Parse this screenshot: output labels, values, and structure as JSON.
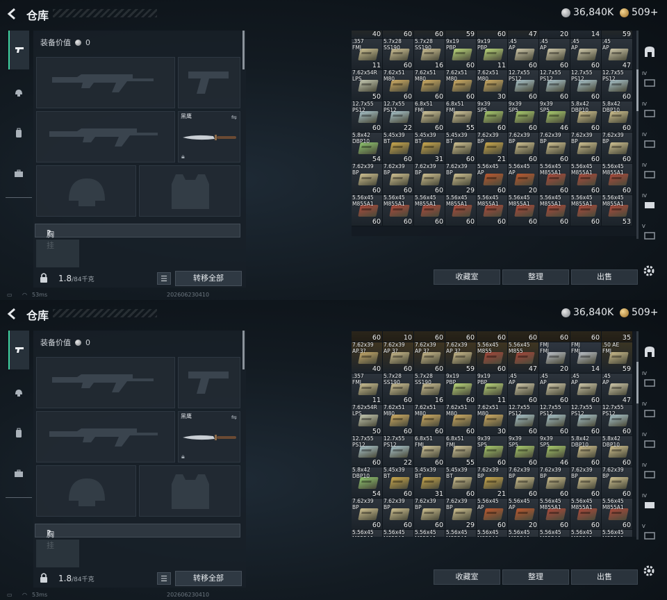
{
  "header": {
    "title": "仓库",
    "silver": "36,840K",
    "gold": "509+"
  },
  "gear": {
    "equip_value_label": "装备价值",
    "equip_value": "0",
    "knife_name": "黑鹰",
    "chest_rig_label": "胸挂",
    "chest_rig_help": "?",
    "weight": "1.8",
    "weight_max": "/84千克",
    "transfer_all": "转移全部"
  },
  "status": {
    "ping": "53ms",
    "build": "202606230410"
  },
  "actions": {
    "collection": "收藏室",
    "sort": "整理",
    "sell": "出售"
  },
  "tabs": {
    "left": [
      "weapon-tab",
      "armor-tab",
      "bag-tab",
      "case-tab"
    ]
  },
  "colors": {
    "accent": "#3fd4a2",
    "panel": "#182028"
  },
  "stash_rows": [
    [
      {
        "label": "7.62x39\nAP.3?",
        "count": "40",
        "color": "#c3a86a",
        "bg": "#3f3521"
      },
      {
        "label": "7.62x39\nAP 3?",
        "count": "60",
        "color": "#c9b98b",
        "bg": "#3f3521"
      },
      {
        "label": "7.62x39\nAP 3?",
        "count": "60",
        "color": "#c9b98b",
        "bg": "#3f3521"
      },
      {
        "label": "7.62x39\nAP 3?",
        "count": "59",
        "color": "#c9b98b",
        "bg": "#3f3521"
      },
      {
        "label": "5.56x45\nM855",
        "count": "60",
        "color": "#a5473a",
        "bg": "#3f3521"
      },
      {
        "label": "5.56x45\nM855",
        "count": "47",
        "color": "#a5473a",
        "bg": "#3f3521"
      },
      {
        "label": "FMJ\nFMJ",
        "count": "20",
        "color": "#b9bec6",
        "bg": "#2f3640"
      },
      {
        "label": "FMJ\nFMJ",
        "count": "14",
        "color": "#b9bec6",
        "bg": "#2f3640"
      },
      {
        "label": ".50 AE\nFMJ",
        "count": "59",
        "color": "#c8b98a",
        "bg": "#3a3524"
      }
    ],
    [
      {
        "label": ".357\nFMJ",
        "count": "11",
        "color": "#cbbf92",
        "bg": "#2d343c"
      },
      {
        "label": "5.7x28\nSS190",
        "count": "60",
        "color": "#cfc296",
        "bg": "#2d343c"
      },
      {
        "label": "5.7x28\nSS190",
        "count": "16",
        "color": "#cfc296",
        "bg": "#2d343c"
      },
      {
        "label": "9x19\nPBP",
        "count": "60",
        "color": "#b8d47a",
        "bg": "#2d343c"
      },
      {
        "label": "9x19\nPBP",
        "count": "11",
        "color": "#b8d47a",
        "bg": "#2d343c"
      },
      {
        "label": ".45\nAP",
        "count": "60",
        "color": "#cdc6a8",
        "bg": "#2d343c"
      },
      {
        "label": ".45\nAP",
        "count": "60",
        "color": "#cdc6a8",
        "bg": "#2d343c"
      },
      {
        "label": ".45\nAP",
        "count": "60",
        "color": "#cdc6a8",
        "bg": "#2d343c"
      },
      {
        "label": ".45\nAP",
        "count": "47",
        "color": "#cdc6a8",
        "bg": "#2d343c"
      }
    ],
    [
      {
        "label": "7.62x54R\nLPS",
        "count": "50",
        "color": "#c3c7b0",
        "bg": "#2d343c"
      },
      {
        "label": "7.62x51\nM80",
        "count": "60",
        "color": "#d0ad64",
        "bg": "#2d343c"
      },
      {
        "label": "7.62x51\nM80",
        "count": "60",
        "color": "#d0ad64",
        "bg": "#2d343c"
      },
      {
        "label": "7.62x51\nM80",
        "count": "60",
        "color": "#d0ad64",
        "bg": "#2d343c"
      },
      {
        "label": "7.62x51\nM80",
        "count": "30",
        "color": "#d0ad64",
        "bg": "#2d343c"
      },
      {
        "label": "12.7x55\nPS12",
        "count": "60",
        "color": "#a9c4cc",
        "bg": "#2d343c"
      },
      {
        "label": "12.7x55\nPS12",
        "count": "60",
        "color": "#a9c4cc",
        "bg": "#2d343c"
      },
      {
        "label": "12.7x55\nPS12",
        "count": "60",
        "color": "#a9c4cc",
        "bg": "#2d343c"
      },
      {
        "label": "12.7x55\nPS12",
        "count": "60",
        "color": "#a9c4cc",
        "bg": "#2d343c"
      }
    ],
    [
      {
        "label": "12.7x55\nPS12",
        "count": "60",
        "color": "#a9c4cc",
        "bg": "#2d343c"
      },
      {
        "label": "12.7x55\nPS12",
        "count": "22",
        "color": "#a9c4cc",
        "bg": "#2d343c"
      },
      {
        "label": "6.8x51\nFMJ",
        "count": "60",
        "color": "#d2c69c",
        "bg": "#2d343c"
      },
      {
        "label": "6.8x51\nFMJ",
        "count": "55",
        "color": "#d2c69c",
        "bg": "#2d343c"
      },
      {
        "label": "9x39\nSP5",
        "count": "60",
        "color": "#a7c96c",
        "bg": "#2d343c"
      },
      {
        "label": "9x39\nSP5",
        "count": "60",
        "color": "#a7c96c",
        "bg": "#2d343c"
      },
      {
        "label": "9x39\nSP5",
        "count": "46",
        "color": "#a7c96c",
        "bg": "#2d343c"
      },
      {
        "label": "5.8x42\nDBP10",
        "count": "60",
        "color": "#d1c290",
        "bg": "#2d343c"
      },
      {
        "label": "5.8x42\nDBP10",
        "count": "60",
        "color": "#d1c290",
        "bg": "#2d343c"
      }
    ],
    [
      {
        "label": "5.8x42\nDBP10",
        "count": "54",
        "color": "#8fc56f",
        "bg": "#2d343c"
      },
      {
        "label": "5.45x39\nBT",
        "count": "60",
        "color": "#c7a64c",
        "bg": "#2d343c"
      },
      {
        "label": "5.45x39\nBT",
        "count": "31",
        "color": "#c7a64c",
        "bg": "#2d343c"
      },
      {
        "label": "5.45x39\nBT",
        "count": "60",
        "color": "#cdbf90",
        "bg": "#2d343c"
      },
      {
        "label": "7.62x39\nBP",
        "count": "21",
        "color": "#c7a64c",
        "bg": "#2d343c"
      },
      {
        "label": "7.62x39\nBP",
        "count": "60",
        "color": "#cdbf90",
        "bg": "#2d343c"
      },
      {
        "label": "7.62x39\nBP",
        "count": "60",
        "color": "#cdbf90",
        "bg": "#2d343c"
      },
      {
        "label": "7.62x39\nBP",
        "count": "60",
        "color": "#cdbf90",
        "bg": "#2d343c"
      },
      {
        "label": "7.62x39\nBP",
        "count": "60",
        "color": "#cdbf90",
        "bg": "#2d343c"
      }
    ],
    [
      {
        "label": "7.62x39\nBP",
        "count": "60",
        "color": "#cdbf90",
        "bg": "#2d343c"
      },
      {
        "label": "7.62x39\nBP",
        "count": "60",
        "color": "#cdbf90",
        "bg": "#2d343c"
      },
      {
        "label": "7.62x39\nBP",
        "count": "60",
        "color": "#cdbf90",
        "bg": "#2d343c"
      },
      {
        "label": "7.62x39\nBP",
        "count": "29",
        "color": "#cdbf90",
        "bg": "#2d343c"
      },
      {
        "label": "5.56x45\nAP",
        "count": "60",
        "color": "#b9582f",
        "bg": "#2d343c"
      },
      {
        "label": "5.56x45\nAP",
        "count": "20",
        "color": "#b9582f",
        "bg": "#2d343c"
      },
      {
        "label": "5.56x45\nM855A1",
        "count": "60",
        "color": "#ad4a3c",
        "bg": "#2d343c"
      },
      {
        "label": "5.56x45\nM855A1",
        "count": "60",
        "color": "#ad4a3c",
        "bg": "#2d343c"
      },
      {
        "label": "5.56x45\nM855A1",
        "count": "60",
        "color": "#ad4a3c",
        "bg": "#2d343c"
      }
    ],
    [
      {
        "label": "5.56x45\nM855A1",
        "count": "60",
        "color": "#ad4a3c",
        "bg": "#2d343c"
      },
      {
        "label": "5.56x45\nM855A1",
        "count": "60",
        "color": "#ad4a3c",
        "bg": "#2d343c"
      },
      {
        "label": "5.56x45\nM855A1",
        "count": "60",
        "color": "#ad4a3c",
        "bg": "#2d343c"
      },
      {
        "label": "5.56x45\nM855A1",
        "count": "60",
        "color": "#ad4a3c",
        "bg": "#2d343c"
      },
      {
        "label": "5.56x45\nM855A1",
        "count": "60",
        "color": "#ad4a3c",
        "bg": "#2d343c"
      },
      {
        "label": "5.56x45\nM855A1",
        "count": "60",
        "color": "#ad4a3c",
        "bg": "#2d343c"
      },
      {
        "label": "5.56x45\nM855A1",
        "count": "60",
        "color": "#ad4a3c",
        "bg": "#2d343c"
      },
      {
        "label": "5.56x45\nM855A1",
        "count": "60",
        "color": "#ad4a3c",
        "bg": "#2d343c"
      },
      {
        "label": "5.56x45\nM855A1",
        "count": "53",
        "color": "#ad4a3c",
        "bg": "#2d343c"
      }
    ]
  ],
  "stash_top_counts": [
    "60",
    "10",
    "60",
    "60",
    "60",
    "60",
    "60",
    "60",
    "35"
  ]
}
